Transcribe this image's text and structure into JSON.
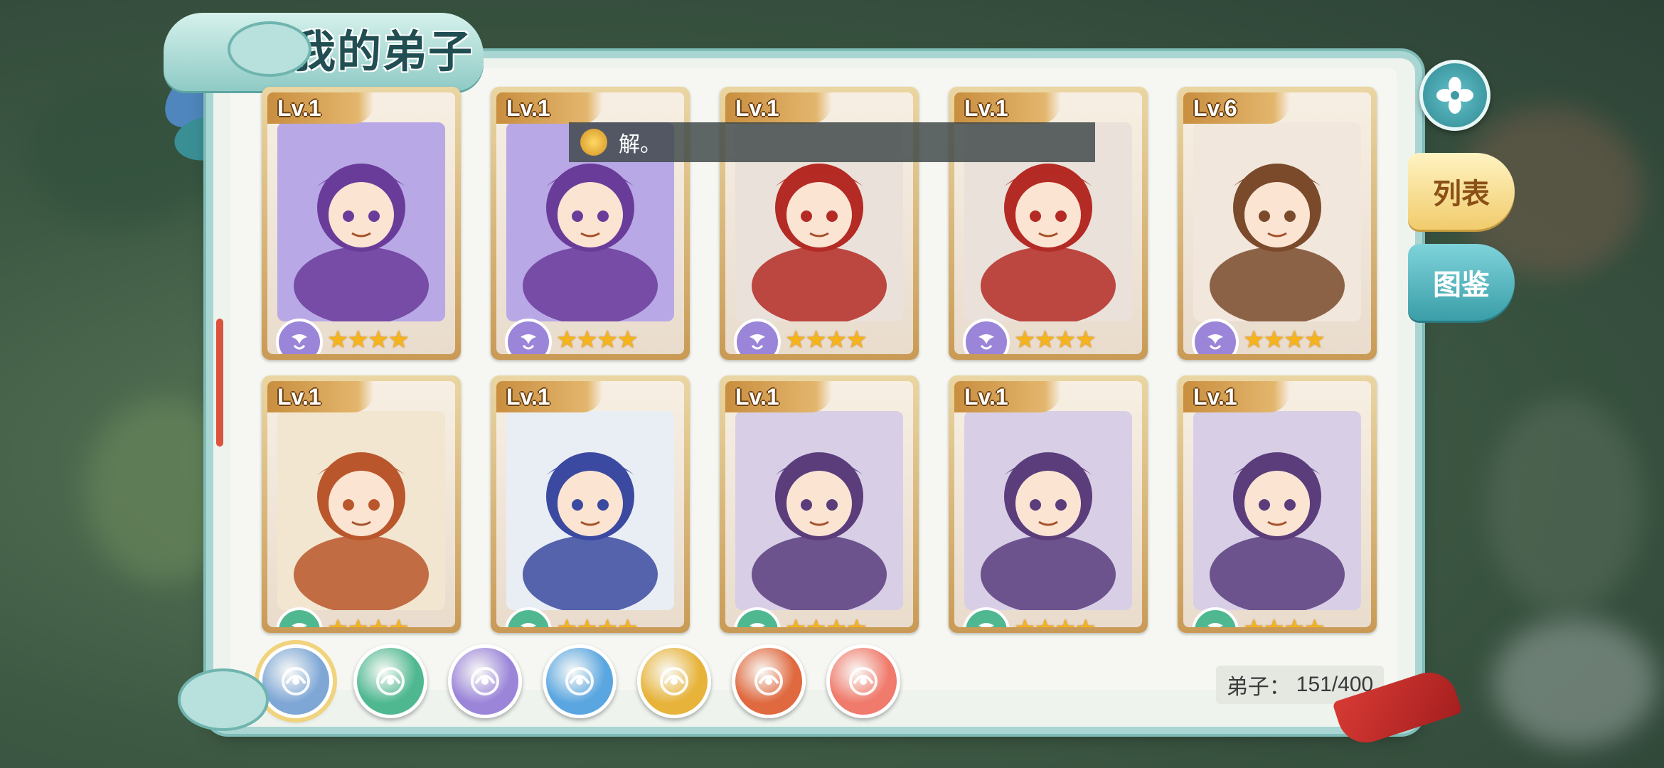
{
  "screen_title": "我的弟子",
  "side_tabs": {
    "list": "列表",
    "codex": "图鉴"
  },
  "notice": {
    "text": "解。"
  },
  "cards": [
    {
      "level": "Lv.1",
      "element": "wind",
      "stars": "★★★★",
      "portrait": "purple-hair-mage",
      "colors": [
        "#b9a8e6",
        "#6a3c9a"
      ]
    },
    {
      "level": "Lv.1",
      "element": "wind",
      "stars": "★★★★",
      "portrait": "purple-hair-mage",
      "colors": [
        "#b9a8e6",
        "#6a3c9a"
      ]
    },
    {
      "level": "Lv.1",
      "element": "wind",
      "stars": "★★★★",
      "portrait": "red-mask-warrior",
      "colors": [
        "#eae2da",
        "#b42a24"
      ]
    },
    {
      "level": "Lv.1",
      "element": "wind",
      "stars": "★★★★",
      "portrait": "red-mask-warrior",
      "colors": [
        "#eae2da",
        "#b42a24"
      ]
    },
    {
      "level": "Lv.6",
      "element": "wind",
      "stars": "★★★★",
      "portrait": "lion-rider",
      "colors": [
        "#f1e7dc",
        "#7a4a2b"
      ]
    },
    {
      "level": "Lv.1",
      "element": "yinyang",
      "stars": "★★★★",
      "portrait": "monk-warrior",
      "colors": [
        "#f3e6d0",
        "#b9562b"
      ]
    },
    {
      "level": "Lv.1",
      "element": "yinyang",
      "stars": "★★★★",
      "portrait": "lute-player",
      "colors": [
        "#e9eef5",
        "#3b4aa0"
      ]
    },
    {
      "level": "Lv.1",
      "element": "yinyang",
      "stars": "★★★★",
      "portrait": "silver-hair-swordswoman",
      "colors": [
        "#d8cfe6",
        "#5b3d7c"
      ]
    },
    {
      "level": "Lv.1",
      "element": "yinyang",
      "stars": "★★★★",
      "portrait": "silver-hair-swordswoman",
      "colors": [
        "#d8cfe6",
        "#5b3d7c"
      ]
    },
    {
      "level": "Lv.1",
      "element": "yinyang",
      "stars": "★★★★",
      "portrait": "silver-hair-swordswoman",
      "colors": [
        "#d8cfe6",
        "#5b3d7c"
      ]
    }
  ],
  "filters": [
    {
      "name": "all-elements",
      "color": "#7ea7d6",
      "selected": true
    },
    {
      "name": "yinyang",
      "color": "#4fb891",
      "selected": false
    },
    {
      "name": "wind",
      "color": "#9b85d9",
      "selected": false
    },
    {
      "name": "water",
      "color": "#5aa6e0",
      "selected": false
    },
    {
      "name": "lotus",
      "color": "#e7b33a",
      "selected": false
    },
    {
      "name": "fire",
      "color": "#e0693f",
      "selected": false
    },
    {
      "name": "cloud",
      "color": "#f07a6b",
      "selected": false
    }
  ],
  "counter": {
    "label": "弟子：",
    "value": "151/400"
  },
  "colors": {
    "panel_border": "#7fbcb8",
    "card_gold": "#c99a55",
    "star": "#f5b31d"
  }
}
